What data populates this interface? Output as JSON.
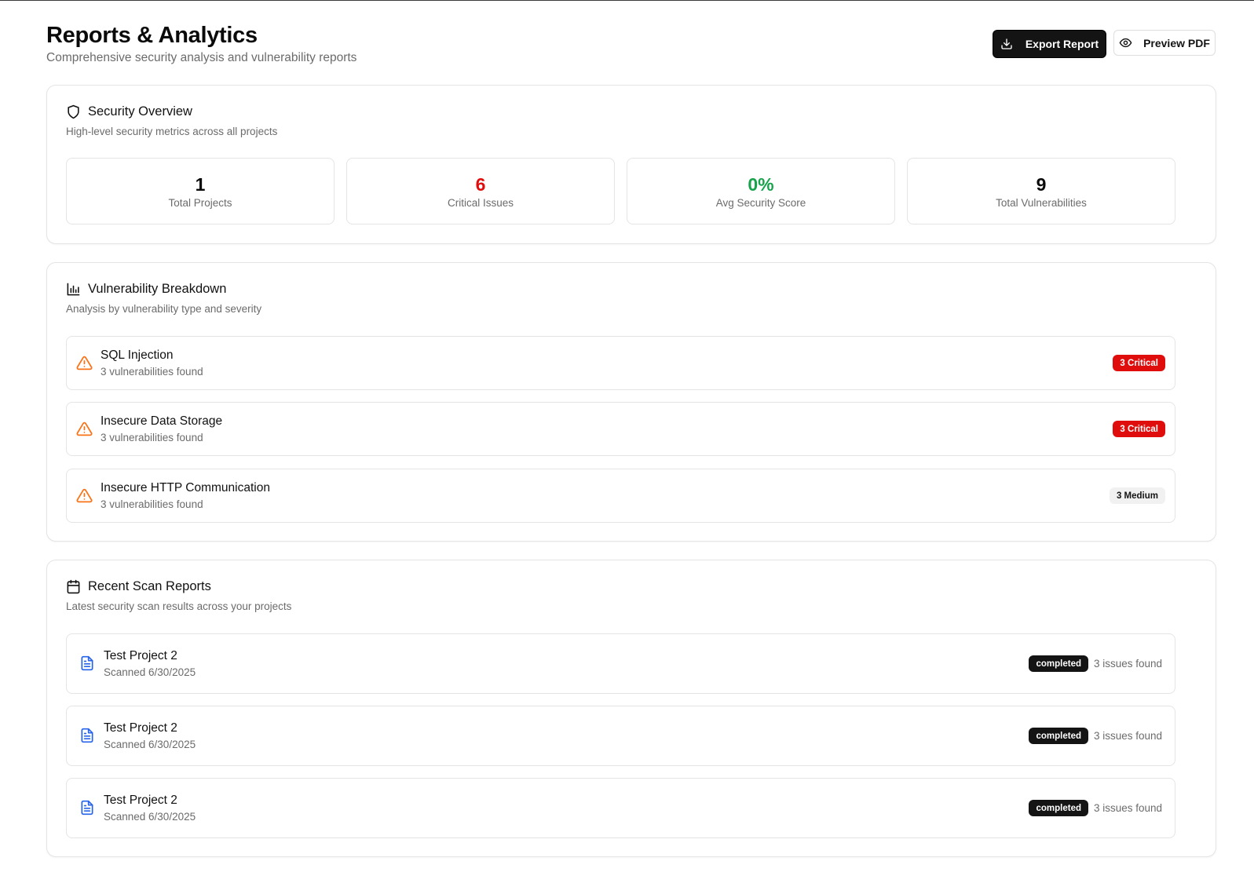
{
  "header": {
    "title": "Reports & Analytics",
    "subtitle": "Comprehensive security analysis and vulnerability reports",
    "export_label": "Export Report",
    "preview_label": "Preview PDF"
  },
  "overview": {
    "title": "Security Overview",
    "description": "High-level security metrics across all projects",
    "stats": [
      {
        "value": "1",
        "label": "Total Projects",
        "color": "#0a0a0a"
      },
      {
        "value": "6",
        "label": "Critical Issues",
        "color": "#e00d0d"
      },
      {
        "value": "0%",
        "label": "Avg Security Score",
        "color": "#16a34a"
      },
      {
        "value": "9",
        "label": "Total Vulnerabilities",
        "color": "#0a0a0a"
      }
    ]
  },
  "breakdown": {
    "title": "Vulnerability Breakdown",
    "description": "Analysis by vulnerability type and severity",
    "items": [
      {
        "name": "SQL Injection",
        "count": "3 vulnerabilities found",
        "badge": "3 Critical",
        "severity": "critical"
      },
      {
        "name": "Insecure Data Storage",
        "count": "3 vulnerabilities found",
        "badge": "3 Critical",
        "severity": "critical"
      },
      {
        "name": "Insecure HTTP Communication",
        "count": "3 vulnerabilities found",
        "badge": "3 Medium",
        "severity": "medium"
      }
    ],
    "warning_color": "#f97316"
  },
  "scans": {
    "title": "Recent Scan Reports",
    "description": "Latest security scan results across your projects",
    "items": [
      {
        "name": "Test Project 2",
        "date": "Scanned 6/30/2025",
        "status": "completed",
        "issues": "3 issues found"
      },
      {
        "name": "Test Project 2",
        "date": "Scanned 6/30/2025",
        "status": "completed",
        "issues": "3 issues found"
      },
      {
        "name": "Test Project 2",
        "date": "Scanned 6/30/2025",
        "status": "completed",
        "issues": "3 issues found"
      }
    ],
    "file_icon_color": "#2563eb"
  }
}
